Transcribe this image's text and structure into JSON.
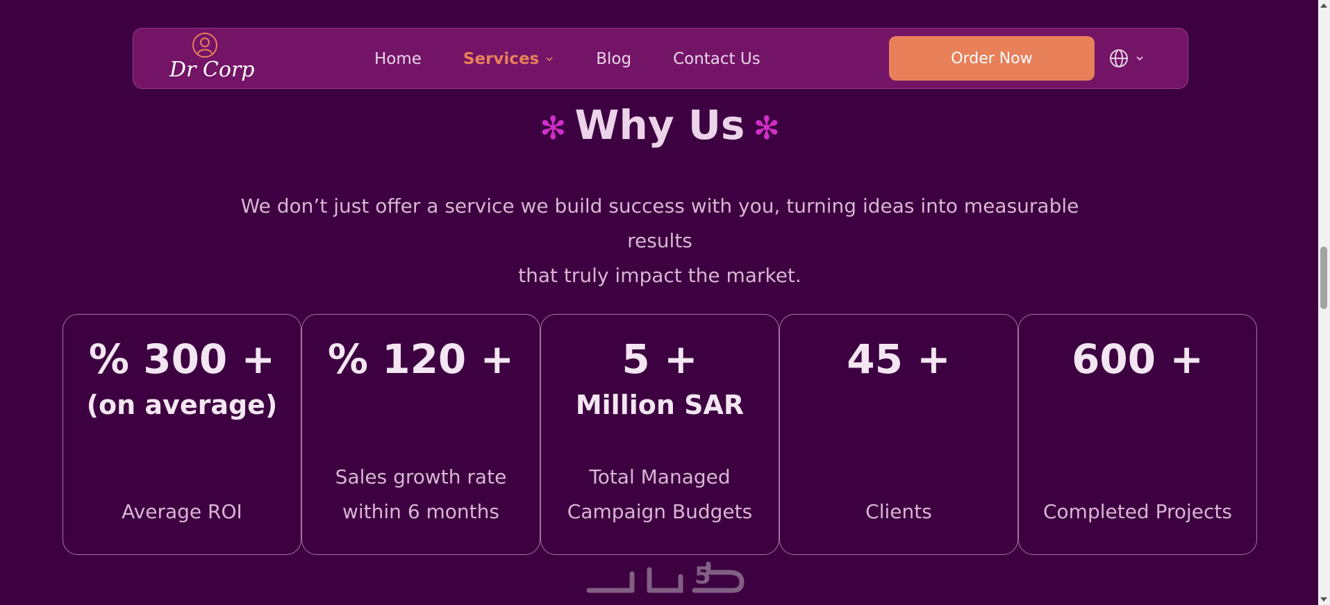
{
  "logo": {
    "text": "Dr Corp",
    "icon": "person-avatar-icon"
  },
  "nav": {
    "items": [
      {
        "label": "Home",
        "active": false
      },
      {
        "label": "Services",
        "active": true,
        "dropdown": true
      },
      {
        "label": "Blog",
        "active": false
      },
      {
        "label": "Contact Us",
        "active": false
      }
    ],
    "order_label": "Order Now",
    "language_icon": "globe-icon"
  },
  "section": {
    "title": "Why Us",
    "subtitle_line1": "We don’t just offer a service we build success with you, turning ideas into measurable results",
    "subtitle_line2": "that truly impact the market."
  },
  "stats": [
    {
      "value": "% 300 +",
      "unit": "(on average)",
      "label_line1": "",
      "label_line2": "Average ROI"
    },
    {
      "value": "% 120 +",
      "unit": "",
      "label_line1": "Sales growth rate",
      "label_line2": "within 6 months"
    },
    {
      "value": "5 +",
      "unit": "Million SAR",
      "label_line1": "Total Managed",
      "label_line2": "Campaign Budgets"
    },
    {
      "value": "45 +",
      "unit": "",
      "label_line1": "",
      "label_line2": "Clients"
    },
    {
      "value": "600 +",
      "unit": "",
      "label_line1": "",
      "label_line2": "Completed Projects"
    }
  ],
  "colors": {
    "background": "#3d0040",
    "navbar": "#741467",
    "accent": "#e8805a",
    "star": "#d12fc7"
  }
}
